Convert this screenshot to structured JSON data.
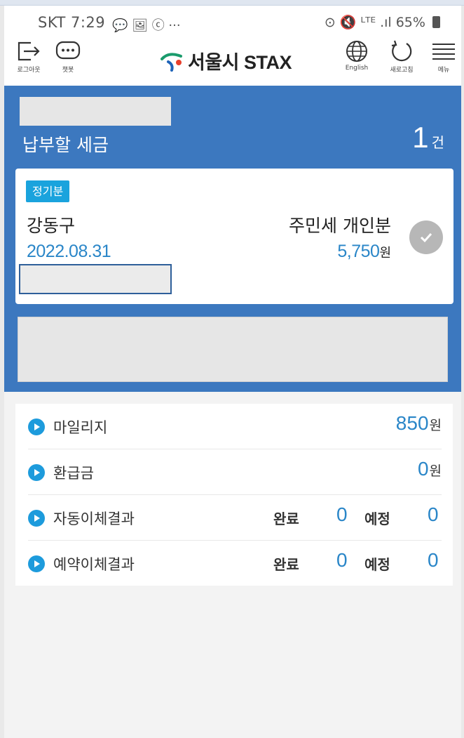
{
  "status_bar": {
    "carrier": "SKT",
    "time": "7:29",
    "notif_icons": "💬 🖼 ⓒ ···",
    "right_icons": "⊙ 🔇 ᴸᵀᴱ .ıl",
    "battery": "65%"
  },
  "header": {
    "logout_label": "로그아웃",
    "chat_label": "챗봇",
    "brand": "서울시 STAX",
    "english_label": "English",
    "refresh_label": "새로고침",
    "menu_label": "메뉴"
  },
  "summary": {
    "title": "납부할 세금",
    "count": "1",
    "count_unit": "건"
  },
  "tax_card": {
    "badge": "정기분",
    "district": "강동구",
    "tax_name": "주민세 개인분",
    "due_date": "2022.08.31",
    "amount": "5,750",
    "amount_unit": "원"
  },
  "info": {
    "mileage_label": "마일리지",
    "mileage_value": "850",
    "refund_label": "환급금",
    "refund_value": "0",
    "won": "원",
    "auto_transfer_label": "자동이체결과",
    "reserved_transfer_label": "예약이체결과",
    "done_label": "완료",
    "planned_label": "예정",
    "auto_done": "0",
    "auto_planned": "0",
    "reserved_done": "0",
    "reserved_planned": "0"
  },
  "colors": {
    "primary_blue": "#3c78bf",
    "accent_blue": "#2a86c8",
    "badge_blue": "#1aa3dd"
  }
}
